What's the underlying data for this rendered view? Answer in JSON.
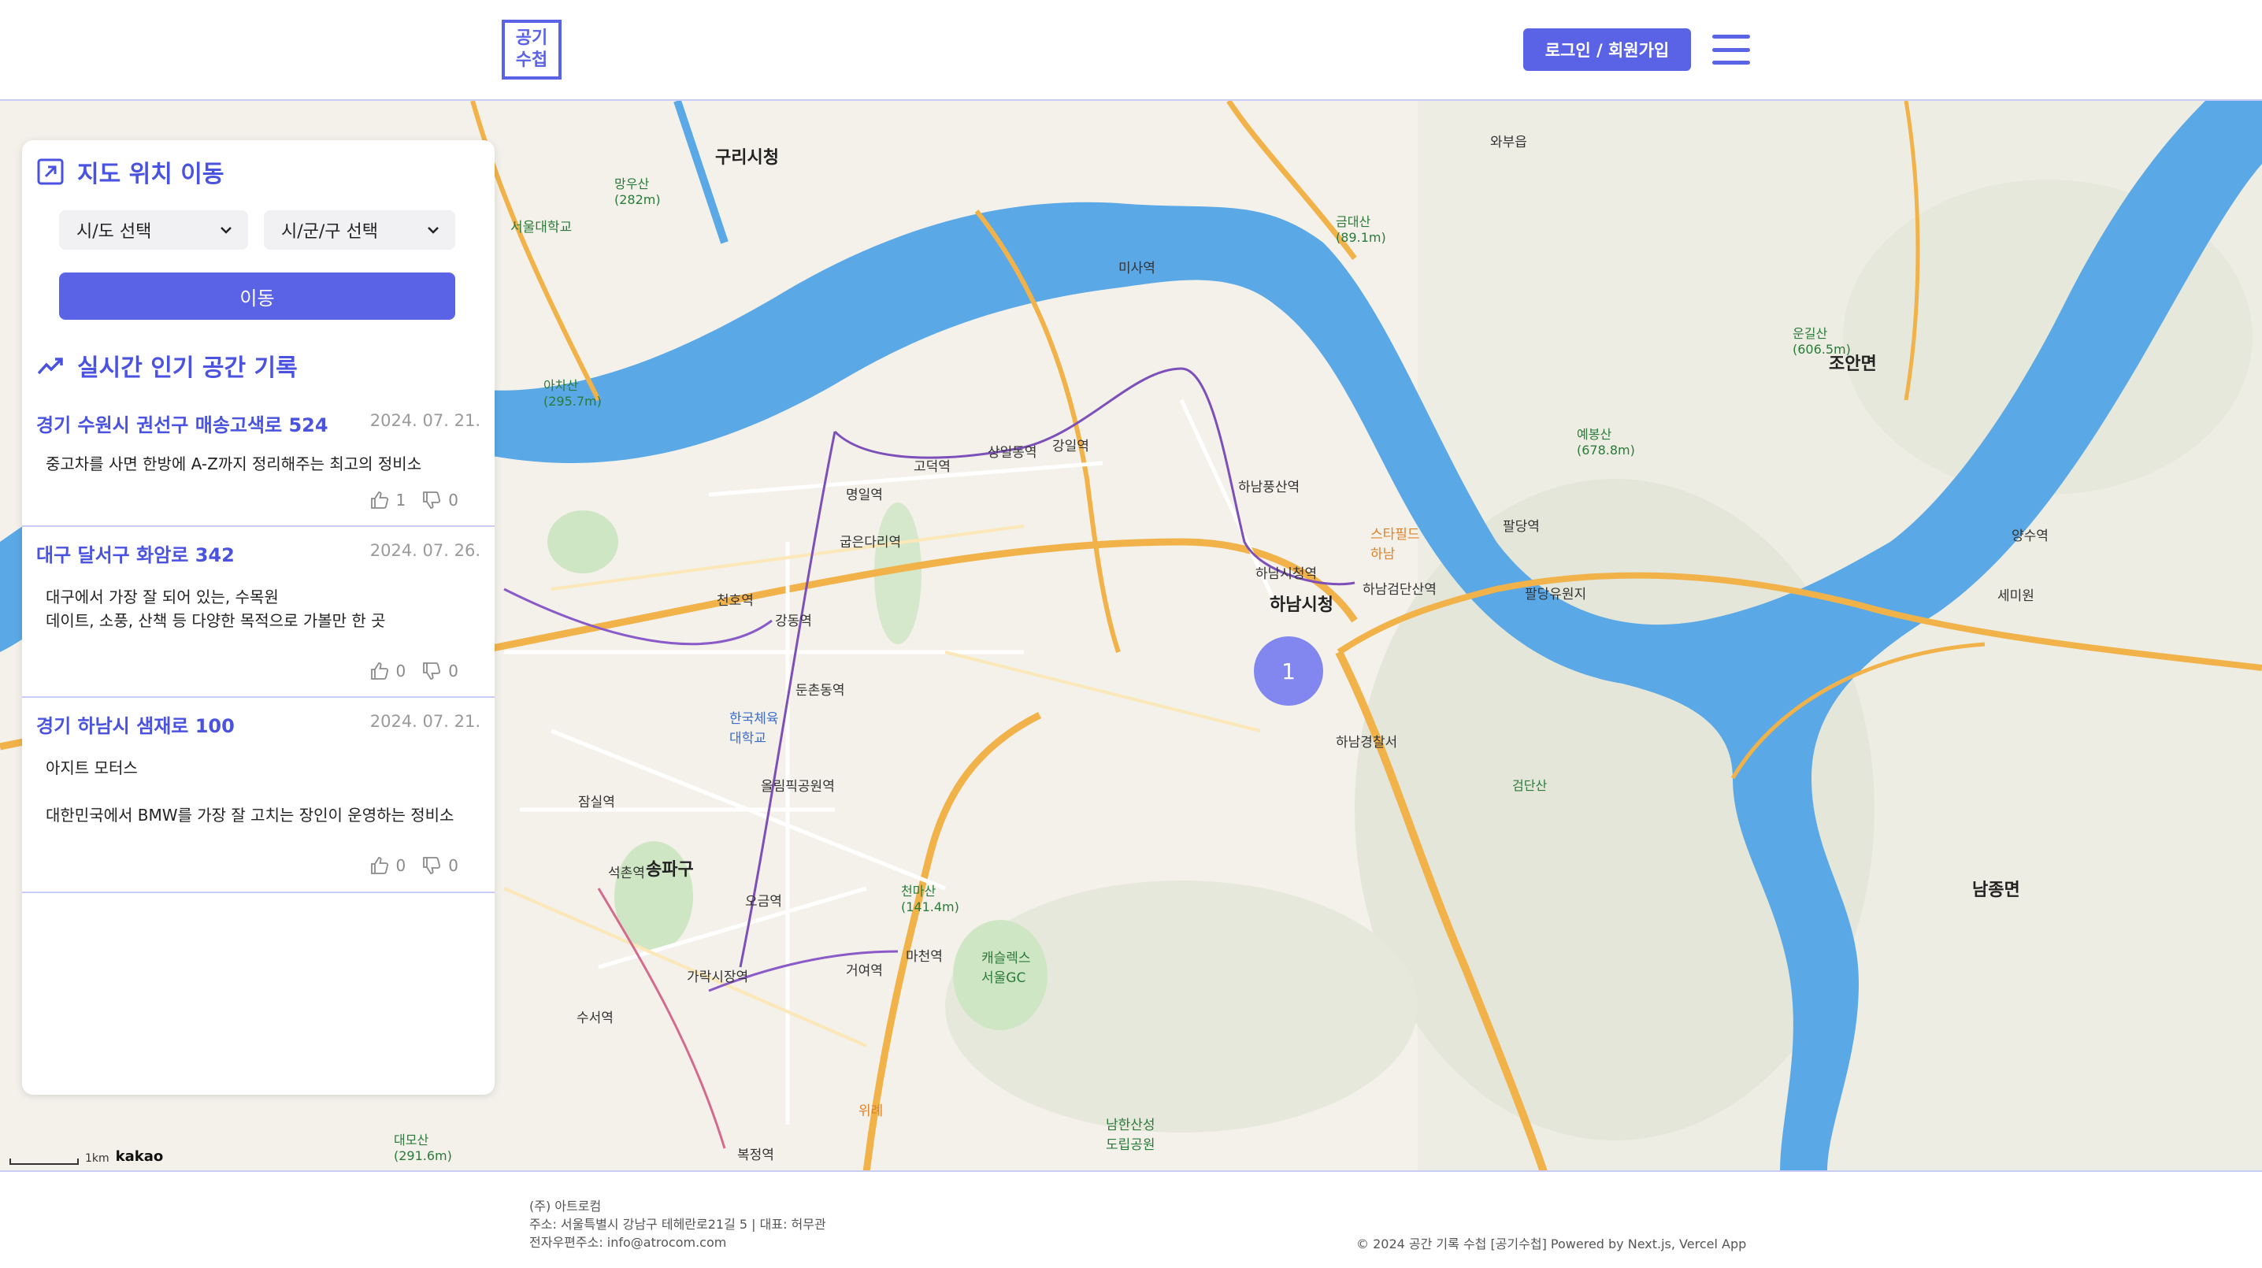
{
  "header": {
    "logo_line1": "공기",
    "logo_line2": "수첩",
    "login_label": "로그인 / 회원가입"
  },
  "map": {
    "cluster_count": "1",
    "scale_label": "1km",
    "provider": "kakao",
    "labels": [
      {
        "text": "구리시청",
        "cls": "big"
      },
      {
        "text": "하남시청",
        "cls": "big"
      },
      {
        "text": "와부읍",
        "cls": ""
      },
      {
        "text": "조안면",
        "cls": "big"
      },
      {
        "text": "남종면",
        "cls": "big"
      },
      {
        "text": "송파구",
        "cls": "big"
      },
      {
        "text": "망우산\n(282m)",
        "cls": "mtn"
      },
      {
        "text": "아차산\n(295.7m)",
        "cls": "mtn"
      },
      {
        "text": "금대산\n(89.1m)",
        "cls": "mtn"
      },
      {
        "text": "운길산\n(606.5m)",
        "cls": "mtn"
      },
      {
        "text": "예봉산\n(678.8m)",
        "cls": "mtn"
      },
      {
        "text": "검단산",
        "cls": "mtn"
      },
      {
        "text": "천마산\n(141.4m)",
        "cls": "mtn"
      },
      {
        "text": "대모산\n(291.6m)",
        "cls": "mtn"
      },
      {
        "text": "미사역",
        "cls": ""
      },
      {
        "text": "하남풍산역",
        "cls": ""
      },
      {
        "text": "하남시청역",
        "cls": ""
      },
      {
        "text": "하남검단산역",
        "cls": ""
      },
      {
        "text": "강일역",
        "cls": ""
      },
      {
        "text": "상일동역",
        "cls": ""
      },
      {
        "text": "고덕역",
        "cls": ""
      },
      {
        "text": "명일역",
        "cls": ""
      },
      {
        "text": "굽은다리역",
        "cls": ""
      },
      {
        "text": "천호역",
        "cls": ""
      },
      {
        "text": "강동역",
        "cls": ""
      },
      {
        "text": "둔촌동역",
        "cls": ""
      },
      {
        "text": "올림픽공원역",
        "cls": ""
      },
      {
        "text": "잠실역",
        "cls": ""
      },
      {
        "text": "석촌역",
        "cls": ""
      },
      {
        "text": "오금역",
        "cls": ""
      },
      {
        "text": "가락시장역",
        "cls": ""
      },
      {
        "text": "수서역",
        "cls": ""
      },
      {
        "text": "복정역",
        "cls": ""
      },
      {
        "text": "마천역",
        "cls": ""
      },
      {
        "text": "거여역",
        "cls": ""
      },
      {
        "text": "팔당역",
        "cls": ""
      },
      {
        "text": "양수역",
        "cls": ""
      },
      {
        "text": "하남경찰서",
        "cls": ""
      },
      {
        "text": "스타필드\n하남",
        "cls": ""
      },
      {
        "text": "팔당유원지",
        "cls": ""
      },
      {
        "text": "세미원",
        "cls": ""
      },
      {
        "text": "서울대학교",
        "cls": ""
      },
      {
        "text": "한국체육\n대학교",
        "cls": ""
      },
      {
        "text": "캐슬렉스\n서울GC",
        "cls": ""
      },
      {
        "text": "남한산성\n도립공원",
        "cls": ""
      },
      {
        "text": "위례",
        "cls": ""
      }
    ]
  },
  "sidebar": {
    "move_title": "지도 위치 이동",
    "sido_placeholder": "시/도 선택",
    "sigungu_placeholder": "시/군/구 선택",
    "move_button": "이동",
    "popular_title": "실시간 인기 공간 기록",
    "posts": [
      {
        "title": "경기 수원시 권선구 매송고색로 524",
        "date": "2024. 07. 21.",
        "body": "중고차를 사면 한방에 A-Z까지 정리해주는 최고의 정비소",
        "likes": "1",
        "dislikes": "0"
      },
      {
        "title": "대구 달서구 화암로 342",
        "date": "2024. 07. 26.",
        "body": "대구에서 가장 잘 되어 있는, 수목원\n데이트, 소풍, 산책 등 다양한 목적으로 가볼만 한 곳",
        "likes": "0",
        "dislikes": "0"
      },
      {
        "title": "경기 하남시 샘재로 100",
        "date": "2024. 07. 21.",
        "body": "아지트 모터스\n\n대한민국에서 BMW를 가장 잘 고치는 장인이 운영하는 정비소",
        "likes": "0",
        "dislikes": "0"
      }
    ]
  },
  "footer": {
    "company": "(주) 아트로컴",
    "address": "주소: 서울특별시 강남구 테헤란로21길 5 | 대표: 허무관",
    "email": "전자우편주소: info@atrocom.com",
    "copyright": "© 2024 공간 기록 수첩 [공기수첩] Powered by Next.js, Vercel App"
  },
  "colors": {
    "accent": "#5a62e6",
    "river": "#5aa8e6",
    "road": "#f1b24a"
  }
}
